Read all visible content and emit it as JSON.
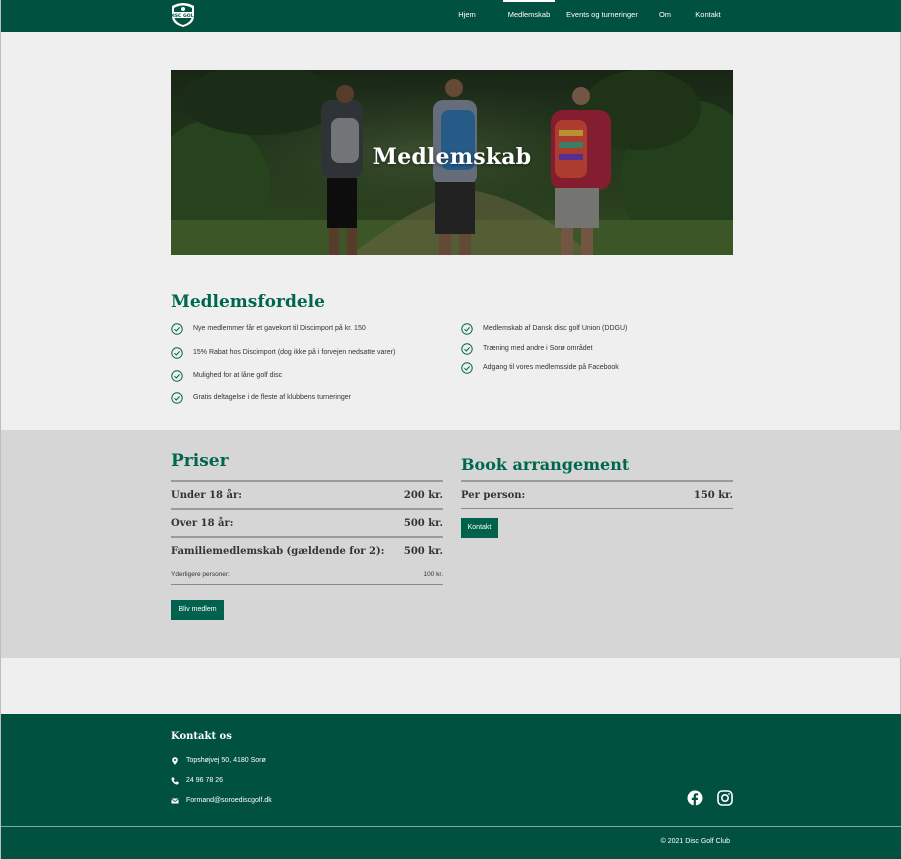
{
  "header": {
    "logo_alt": "Sorø Disc Golf",
    "nav": [
      "Hjem",
      "Medlemskab",
      "Events og turneringer",
      "Om",
      "Kontakt"
    ],
    "active_index": 1
  },
  "hero": {
    "title": "Medlemskab"
  },
  "benefits": {
    "title": "Medlemsfordele",
    "left": [
      "Nye medlemmer får et gavekort til Discimport på kr. 150",
      "15% Rabat hos Discimport (dog ikke på i forvejen nedsatte varer)",
      "Mulighed for at låne golf disc",
      "Gratis deltagelse i de fleste af klubbens turneringer"
    ],
    "right": [
      "Medlemskab af Dansk disc golf Union (DDGU)",
      "Træning med andre i Sorø området",
      "Adgang til vores medlemsside på Facebook"
    ]
  },
  "prices": {
    "title": "Priser",
    "rows": [
      {
        "label": "Under 18 år:",
        "amount": "200 kr."
      },
      {
        "label": "Over 18 år:",
        "amount": "500 kr."
      },
      {
        "label": "Familiemedlemskab (gældende for 2):",
        "amount": "500 kr."
      }
    ],
    "extra": {
      "label": "Yderligere personer:",
      "amount": "100 kr."
    },
    "button": "Bliv medlem"
  },
  "book": {
    "title": "Book arrangement",
    "row": {
      "label": "Per person:",
      "amount": "150 kr."
    },
    "button": "Kontakt"
  },
  "footer": {
    "title": "Kontakt os",
    "address": "Topshøjvej 50, 4180 Sorø",
    "phone": "24 96 78 26",
    "email": "Formand@soroediscgolf.dk",
    "copyright": "© 2021 Disc Golf Club"
  },
  "icons": {
    "check": "check-circle-icon",
    "location": "location-pin-icon",
    "phone": "phone-icon",
    "email": "envelope-icon",
    "facebook": "facebook-icon",
    "instagram": "instagram-icon"
  },
  "colors": {
    "brand_green": "#00513f",
    "heading_green": "#00674f",
    "button_green": "#00614c",
    "page_bg": "#efefef",
    "band_bg": "#d6d6d6"
  }
}
